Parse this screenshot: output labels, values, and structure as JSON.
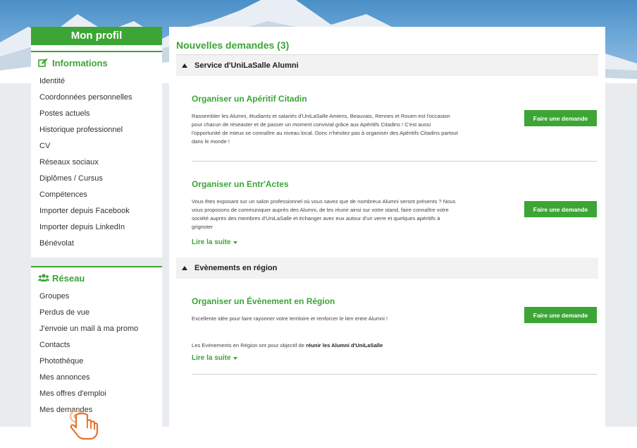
{
  "sidebar": {
    "profile_title": "Mon profil",
    "informations": {
      "title": "Informations",
      "icon": "edit-icon",
      "items": [
        "Identité",
        "Coordonnées personnelles",
        "Postes actuels",
        "Historique professionnel",
        "CV",
        "Réseaux sociaux",
        "Diplômes / Cursus",
        "Compétences",
        "Importer depuis Facebook",
        "Importer depuis LinkedIn",
        "Bénévolat"
      ]
    },
    "reseau": {
      "title": "Réseau",
      "icon": "users-icon",
      "items": [
        "Groupes",
        "Perdus de vue",
        "J'envoie un mail à ma promo",
        "Contacts",
        "Photothèque",
        "Mes annonces",
        "Mes offres d'emploi",
        "Mes demandes"
      ]
    }
  },
  "main": {
    "title": "Nouvelles demandes (3)",
    "groups": [
      {
        "title": "Service d'UniLaSalle Alumni",
        "cards": [
          {
            "title": "Organiser un Apéritif Citadin",
            "text": "Rassembler les Alumni, étudiants et salariés d'UniLaSalle Amiens, Beauvais, Rennes et Rouen est l'occasion pour chacun de réseauter et de passer un moment convivial grâce aux Apéritifs Citadins ! C'est aussi l'opportunité de mieux se connaître au niveau local. Donc n'hésitez pas à organiser des Apéritifs Citadins partout dans le monde !",
            "button": "Faire une demande"
          },
          {
            "title": "Organiser un Entr'Actes",
            "text": "Vous êtes exposant sur un salon professionnel où vous savez que de nombreux Alumni seront présents ? Nous vous proposons de communiquer auprès des Alumni, de les réunir ainsi sur votre stand, faire connaître votre société auprès des membres d'UniLaSalle et échanger avec eux autour d'un verre et quelques apéritifs à grignoter",
            "button": "Faire une demande",
            "more": "Lire la suite"
          }
        ]
      },
      {
        "title": "Evènements en région",
        "cards": [
          {
            "title": "Organiser un Évènement en Région",
            "text": "Excellente idée pour faire rayonner votre territoire et renforcer le lien entre Alumni !",
            "text2_prefix": "Les Evénements en Région ont pour objectif de ",
            "text2_bold": "réunir les Alumni d'UniLaSalle",
            "button": "Faire une demande",
            "more": "Lire la suite"
          }
        ]
      }
    ]
  },
  "colors": {
    "accent": "#3ca535",
    "group_bg": "#f2f2f2",
    "page_bg": "#e9ecef"
  }
}
